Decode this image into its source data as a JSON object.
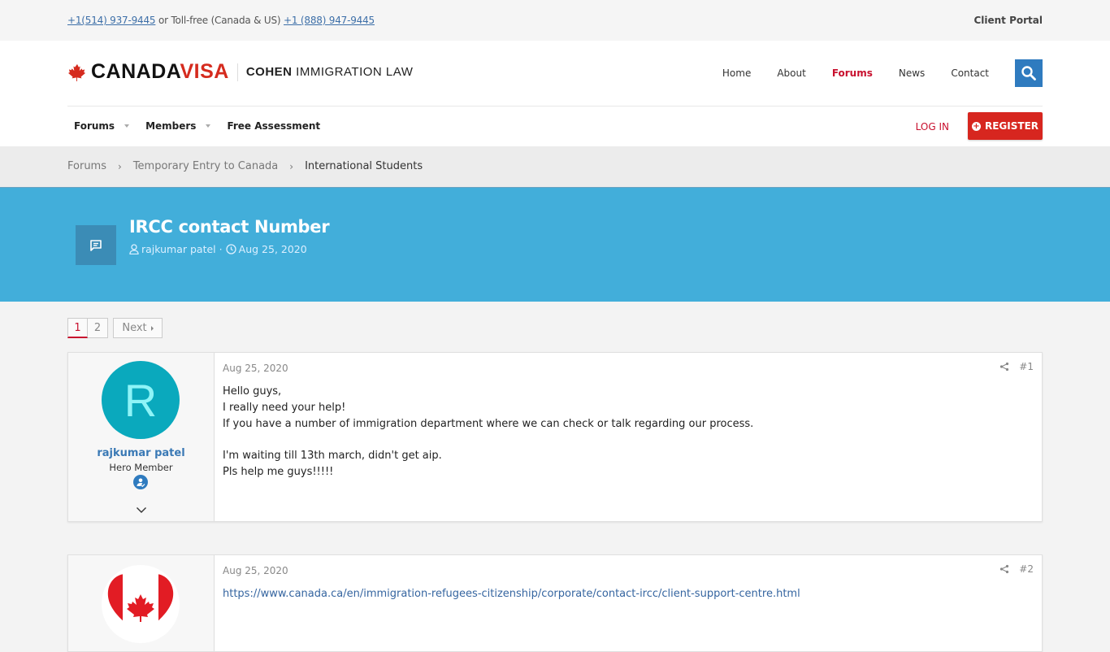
{
  "topbar": {
    "phone_local": "+1(514) 937-9445",
    "separator_text": " or Toll-free (Canada & US) ",
    "phone_tollfree": "+1 (888) 947-9445",
    "client_portal": "Client Portal"
  },
  "logo": {
    "canada": "CANADA",
    "visa": "VISA",
    "cohen": "COHEN",
    "immigration_law": " IMMIGRATION LAW"
  },
  "mainnav": {
    "items": [
      {
        "label": "Home",
        "active": false
      },
      {
        "label": "About",
        "active": false
      },
      {
        "label": "Forums",
        "active": true
      },
      {
        "label": "News",
        "active": false
      },
      {
        "label": "Contact",
        "active": false
      }
    ],
    "search_icon": "search-icon"
  },
  "subnav": {
    "items": [
      {
        "label": "Forums",
        "dropdown": true
      },
      {
        "label": "Members",
        "dropdown": true
      },
      {
        "label": "Free Assessment",
        "dropdown": false
      }
    ],
    "login": "LOG IN",
    "register": "REGISTER"
  },
  "breadcrumb": {
    "items": [
      "Forums",
      "Temporary Entry to Canada",
      "International Students"
    ]
  },
  "thread": {
    "title": "IRCC contact Number",
    "author": "rajkumar patel",
    "separator": "·",
    "date": "Aug 25, 2020",
    "icon": "comment-icon"
  },
  "pagination": {
    "pages": [
      "1",
      "2"
    ],
    "current": "1",
    "next": "Next"
  },
  "posts": [
    {
      "user": {
        "avatar_letter": "R",
        "avatar_color": "#0aa9bd",
        "name": "rajkumar patel",
        "title": "Hero Member"
      },
      "date": "Aug 25, 2020",
      "number": "#1",
      "lines": [
        "Hello guys,",
        "I really need your help!",
        "If you have a number of immigration department where we can check or talk regarding our process.",
        "",
        "I'm waiting till 13th march, didn't get aip.",
        "Pls help me guys!!!!!"
      ]
    },
    {
      "user": {
        "avatar": "canada-flag-heart"
      },
      "date": "Aug 25, 2020",
      "number": "#2",
      "link": "https://www.canada.ca/en/immigration-refugees-citizenship/corporate/contact-ircc/client-support-centre.html"
    }
  ],
  "colors": {
    "brand_red": "#d7261f",
    "hero_blue": "#42aeda",
    "link_blue": "#3565a0",
    "search_blue": "#2f7bbf"
  }
}
